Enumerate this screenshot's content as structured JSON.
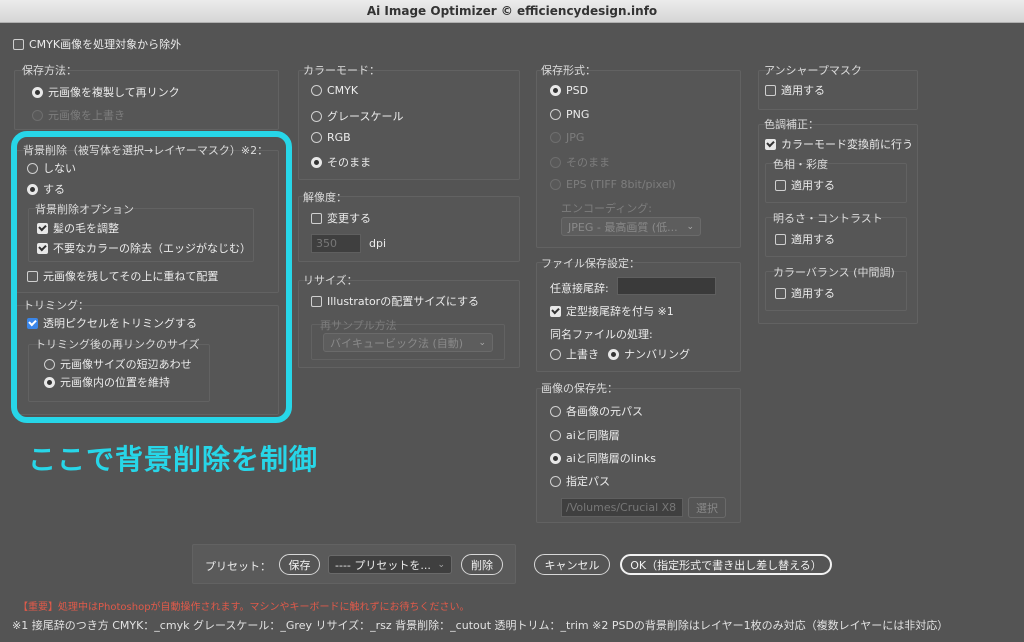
{
  "window": {
    "title": "Ai Image Optimizer © efficiencydesign.info"
  },
  "top_option": {
    "label": "CMYK画像を処理対象から除外",
    "checked": false
  },
  "save_method": {
    "legend": "保存方法：",
    "options": [
      {
        "label": "元画像を複製して再リンク",
        "selected": true,
        "disabled": false
      },
      {
        "label": "元画像を上書き",
        "selected": false,
        "disabled": true
      }
    ]
  },
  "bg_removal": {
    "legend": "背景削除（被写体を選択→レイヤーマスク）※2：",
    "options": [
      {
        "label": "しない",
        "selected": false
      },
      {
        "label": "する",
        "selected": true
      }
    ],
    "sub_legend": "背景削除オプション",
    "sub_options": [
      {
        "label": "髪の毛を調整",
        "checked": true
      },
      {
        "label": "不要なカラーの除去（エッジがなじむ）",
        "checked": true
      }
    ],
    "keep_original": {
      "label": "元画像を残してその上に重ねて配置",
      "checked": false
    }
  },
  "trimming": {
    "legend": "トリミング：",
    "transparent": {
      "label": "透明ピクセルをトリミングする",
      "checked": true
    },
    "relink_legend": "トリミング後の再リンクのサイズ",
    "relink_options": [
      {
        "label": "元画像サイズの短辺あわせ",
        "selected": false
      },
      {
        "label": "元画像内の位置を維持",
        "selected": true
      }
    ]
  },
  "callout": "ここで背景削除を制御",
  "color_mode": {
    "legend": "カラーモード：",
    "options": [
      {
        "label": "CMYK",
        "selected": false
      },
      {
        "label": "グレースケール",
        "selected": false
      },
      {
        "label": "RGB",
        "selected": false
      },
      {
        "label": "そのまま",
        "selected": true
      }
    ]
  },
  "resolution": {
    "legend": "解像度：",
    "change": {
      "label": "変更する",
      "checked": false
    },
    "value": "350",
    "unit": "dpi"
  },
  "resize": {
    "legend": "リサイズ：",
    "illustrator_size": {
      "label": "Illustratorの配置サイズにする",
      "checked": false
    },
    "resample_legend": "再サンプル方法",
    "resample_value": "バイキュービック法 (自動)"
  },
  "save_format": {
    "legend": "保存形式：",
    "options": [
      {
        "label": "PSD",
        "selected": true,
        "disabled": false
      },
      {
        "label": "PNG",
        "selected": false,
        "disabled": false
      },
      {
        "label": "JPG",
        "selected": false,
        "disabled": true
      },
      {
        "label": "そのまま",
        "selected": false,
        "disabled": true
      },
      {
        "label": "EPS (TIFF 8bit/pixel)",
        "selected": false,
        "disabled": true
      }
    ],
    "encoding_legend": "エンコーディング:",
    "encoding_value": "JPEG - 最高画質 (低..."
  },
  "file_settings": {
    "legend": "ファイル保存設定：",
    "suffix_label": "任意接尾辞:",
    "suffix_value": "",
    "fixed_suffix": {
      "label": "定型接尾辞を付与 ※1",
      "checked": true
    },
    "same_name_label": "同名ファイルの処理:",
    "same_name_options": [
      {
        "label": "上書き",
        "selected": false
      },
      {
        "label": "ナンバリング",
        "selected": true
      }
    ]
  },
  "save_dest": {
    "legend": "画像の保存先：",
    "options": [
      {
        "label": "各画像の元パス",
        "selected": false
      },
      {
        "label": "aiと同階層",
        "selected": false
      },
      {
        "label": "aiと同階層のlinks",
        "selected": true
      },
      {
        "label": "指定パス",
        "selected": false
      }
    ],
    "path_value": "/Volumes/Crucial X8",
    "browse_label": "選択"
  },
  "unsharp": {
    "legend": "アンシャープマスク",
    "apply": {
      "label": "適用する",
      "checked": false
    }
  },
  "color_correction": {
    "legend": "色調補正：",
    "before_convert": {
      "label": "カラーモード変換前に行う",
      "checked": true
    },
    "hue_legend": "色相・彩度",
    "hue_apply": {
      "label": "適用する",
      "checked": false
    },
    "bright_legend": "明るさ・コントラスト",
    "bright_apply": {
      "label": "適用する",
      "checked": false
    },
    "balance_legend": "カラーバランス (中間調)",
    "balance_apply": {
      "label": "適用する",
      "checked": false
    }
  },
  "preset": {
    "label": "プリセット：",
    "save_label": "保存",
    "select_value": "---- プリセットを...",
    "delete_label": "削除"
  },
  "cancel_label": "キャンセル",
  "ok_label": "OK（指定形式で書き出し差し替える）",
  "warning": "【重要】処理中はPhotoshopが自動操作されます。マシンやキーボードに触れずにお待ちください。",
  "footnote": "※1 接尾辞のつき方 CMYK：_cmyk グレースケール：_Grey リサイズ：_rsz 背景削除：_cutout 透明トリム：_trim ※2 PSDの背景削除はレイヤー1枚のみ対応（複数レイヤーには非対応）",
  "colors": {
    "accent": "#27d6e8",
    "warning": "#e05a4a",
    "background": "#545454"
  }
}
